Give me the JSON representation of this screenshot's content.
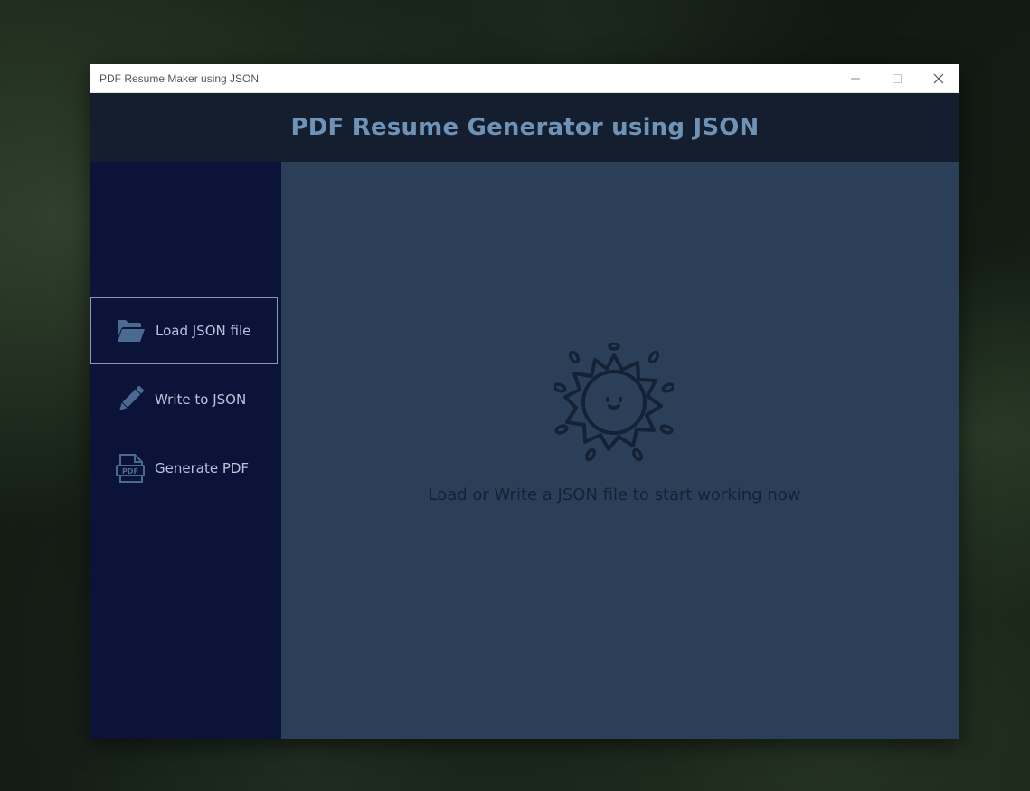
{
  "window": {
    "title": "PDF Resume Maker using JSON",
    "controls": [
      "minimize",
      "maximize",
      "close"
    ]
  },
  "header": {
    "title": "PDF Resume Generator using JSON"
  },
  "sidebar": {
    "items": [
      {
        "label": "Load JSON file",
        "icon": "folder-open-icon",
        "active": true
      },
      {
        "label": "Write to JSON",
        "icon": "pencil-icon",
        "active": false
      },
      {
        "label": "Generate PDF",
        "icon": "pdf-file-icon",
        "active": false
      }
    ]
  },
  "main": {
    "illustration": "smiling-sun-icon",
    "message": "Load or Write a JSON file to start working now"
  },
  "colors": {
    "titlebar": "#ffffff",
    "header_bg": "#141e2f",
    "header_text": "#6f93b7",
    "sidebar_bg": "#0b1438",
    "sidebar_text": "#b9c4dc",
    "main_bg": "#2b4058",
    "main_text": "#152236"
  }
}
